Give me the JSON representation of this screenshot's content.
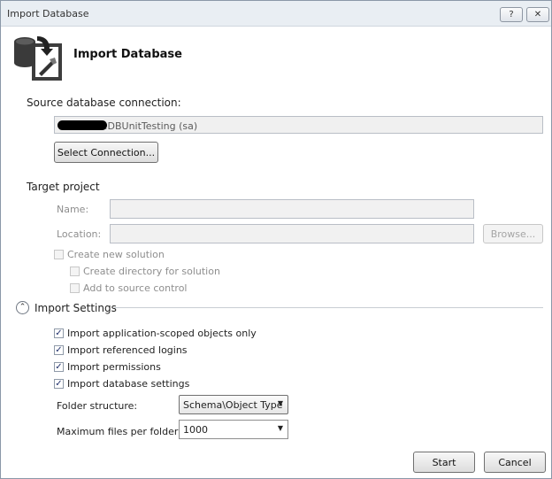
{
  "window": {
    "title": "Import Database",
    "help_label": "?",
    "close_label": "✕"
  },
  "header": {
    "title": "Import Database"
  },
  "source": {
    "heading": "Source database connection:",
    "connection_text": ".DBUnitTesting (sa)",
    "select_button": "Select Connection..."
  },
  "target": {
    "heading": "Target project",
    "name_label": "Name:",
    "name_value": "",
    "location_label": "Location:",
    "location_value": "",
    "browse_button": "Browse...",
    "create_new_solution": "Create new solution",
    "create_directory": "Create directory for solution",
    "add_source_control": "Add to source control"
  },
  "import_settings": {
    "heading": "Import Settings",
    "options": [
      {
        "label": "Import application-scoped objects only",
        "checked": true
      },
      {
        "label": "Import referenced logins",
        "checked": true
      },
      {
        "label": "Import permissions",
        "checked": true
      },
      {
        "label": "Import database settings",
        "checked": true
      }
    ],
    "folder_structure_label": "Folder structure:",
    "folder_structure_value": "Schema\\Object Type",
    "max_files_label": "Maximum files per folder:",
    "max_files_value": "1000"
  },
  "footer": {
    "start_button": "Start",
    "cancel_button": "Cancel"
  },
  "icons": {
    "arrow_glyph": "▼",
    "collapse_glyph": "⌃",
    "check_glyph": "✓"
  }
}
